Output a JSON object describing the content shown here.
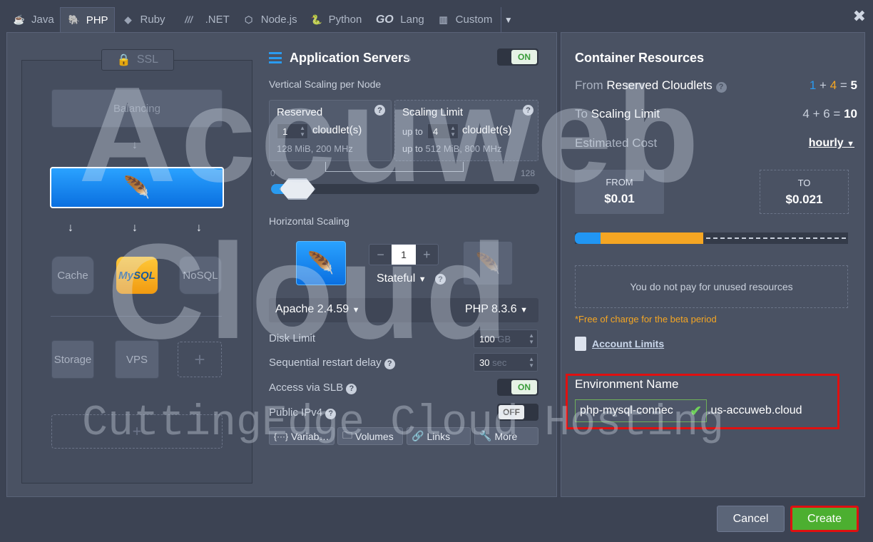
{
  "tabs": [
    {
      "label": "Java",
      "icon": "java-icon"
    },
    {
      "label": "PHP",
      "icon": "php-icon",
      "active": true
    },
    {
      "label": "Ruby",
      "icon": "ruby-icon"
    },
    {
      "label": ".NET",
      "icon": "dotnet-icon"
    },
    {
      "label": "Node.js",
      "icon": "nodejs-icon"
    },
    {
      "label": "Python",
      "icon": "python-icon"
    },
    {
      "label": "Lang",
      "icon": "go-icon",
      "prefix": "GO"
    },
    {
      "label": "Custom",
      "icon": "custom-icon"
    }
  ],
  "topology": {
    "ssl": "SSL",
    "balancing": "Balancing",
    "cache": "Cache",
    "mysql": "MySQL",
    "nosql": "NoSQL",
    "storage": "Storage",
    "vps": "VPS",
    "add": "+"
  },
  "app": {
    "title": "Application Servers",
    "toggle": "ON",
    "vertical_label": "Vertical Scaling per Node",
    "reserved_title": "Reserved",
    "reserved_value": "1",
    "cloudlets_unit": "cloudlet(s)",
    "reserved_spec": "128 MiB, 200 MHz",
    "limit_title": "Scaling Limit",
    "upto": "up to",
    "limit_value": "4",
    "limit_spec": "512 MiB, 800 MHz",
    "slider_min": "0",
    "slider_max": "128",
    "horizontal_label": "Horizontal Scaling",
    "nodes": "1",
    "minus": "−",
    "plus": "+",
    "mode": "Stateful",
    "server": "Apache 2.4.59",
    "php": "PHP 8.3.6",
    "disk_label": "Disk Limit",
    "disk_value": "100",
    "disk_unit": "GB",
    "restart_label": "Sequential restart delay",
    "restart_value": "30",
    "restart_unit": "sec",
    "slb_label": "Access via SLB",
    "slb_toggle": "ON",
    "ipv4_label": "Public IPv4",
    "ipv4_toggle": "OFF",
    "buttons": [
      "Variab…",
      "Volumes",
      "Links",
      "More"
    ]
  },
  "resources": {
    "title": "Container Resources",
    "reserved_label_pre": "From",
    "reserved_label": "Reserved Cloudlets",
    "reserved_a": "1",
    "reserved_b": "4",
    "reserved_total": "5",
    "limit_label_pre": "To",
    "limit_label": "Scaling Limit",
    "limit_a": "4",
    "limit_b": "6",
    "limit_total": "10",
    "cost_label": "Estimated Cost",
    "cost_period": "hourly",
    "from_label": "FROM",
    "from_value": "$0.01",
    "to_label": "TO",
    "to_value": "$0.021",
    "unused_note": "You do not pay for unused resources",
    "beta_note": "*Free of charge for the beta period",
    "account_limits": "Account Limits",
    "env_label": "Environment Name",
    "env_value": "php-mysql-connec",
    "env_domain": ".us-accuweb.cloud"
  },
  "footer": {
    "cancel": "Cancel",
    "create": "Create"
  },
  "watermark": {
    "line1": "Accuweb",
    "line2": "Cloud",
    "line3": "CuttingEdge Cloud Hosting"
  },
  "colors": {
    "accent": "#1d8cf8",
    "create": "#4caf30",
    "highlight": "#e01010",
    "cost_blue": "#2196f3",
    "cost_orange": "#f5a623"
  }
}
